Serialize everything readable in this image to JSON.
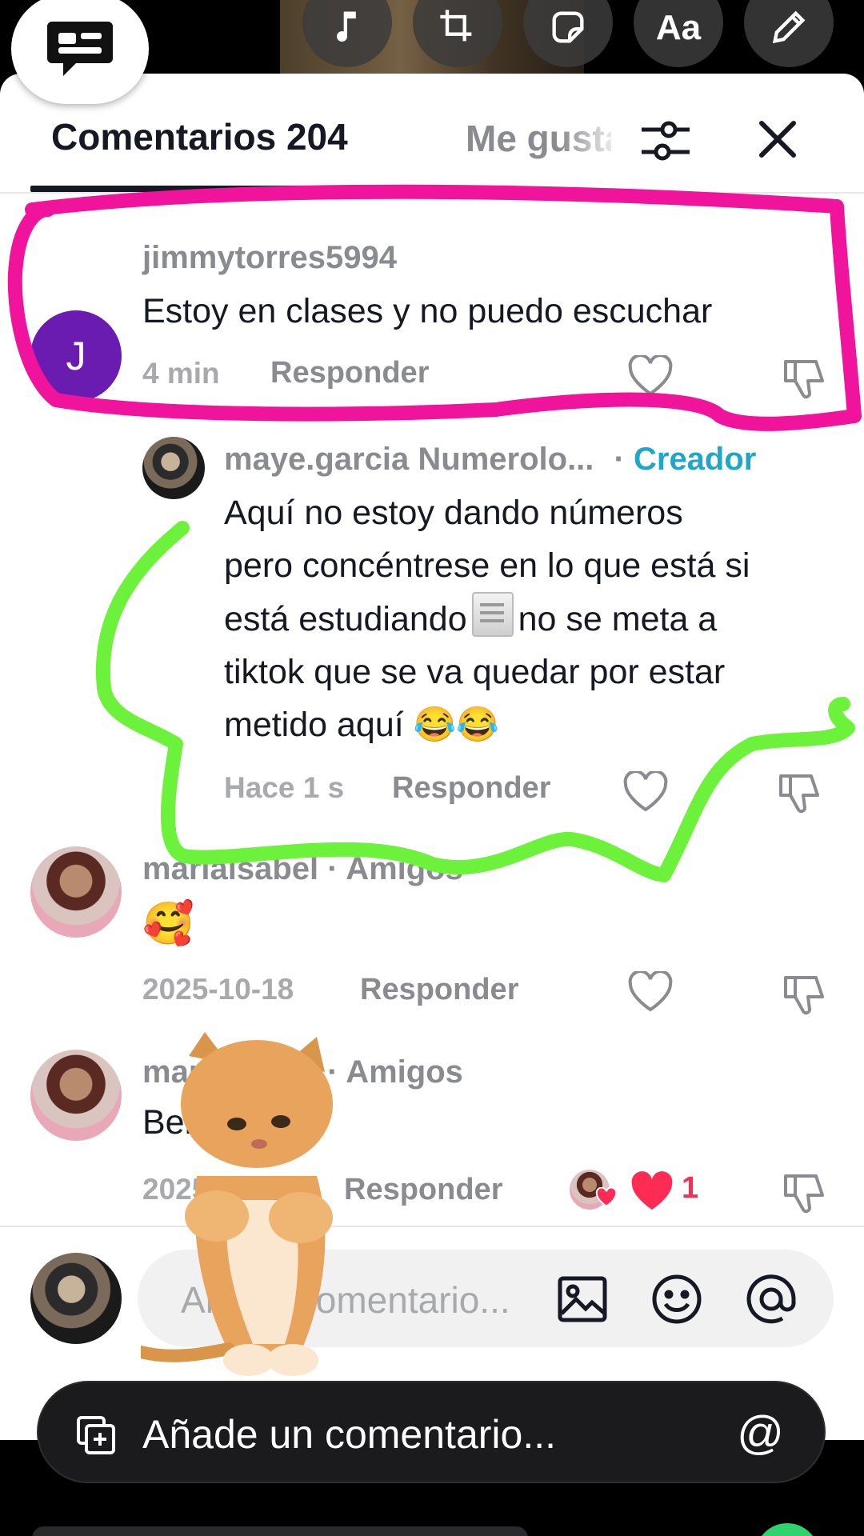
{
  "editor_toolbar": {
    "tools": [
      "music-icon",
      "crop-icon",
      "sticker-icon",
      "text-tool",
      "pencil-icon"
    ],
    "text_tool_label": "Aa"
  },
  "tabs": {
    "comments_label": "Comentarios 204",
    "likes_label": "Me gusta"
  },
  "comments": [
    {
      "username": "jimmytorres5994",
      "avatar_letter": "J",
      "text": "Estoy en clases y no puedo escuchar",
      "time": "4 min",
      "reply_label": "Responder"
    },
    {
      "username": "maye.garcia Numerolo...",
      "separator": "·",
      "badge": "Creador",
      "text_line1": "Aquí no estoy dando números",
      "text_line2": "pero concéntrese en lo que está si",
      "text_line3a": "está estudiando",
      "text_line3b": "no se meta a",
      "text_line4": "tiktok que se va quedar por estar",
      "text_line5": "metido aquí 😂😂",
      "time": "Hace 1 s",
      "reply_label": "Responder"
    },
    {
      "username": "mariaisabel · Amigos",
      "text": "🥰",
      "time": "2025-10-18",
      "reply_label": "Responder"
    },
    {
      "username": "mariaisabel · Amigos",
      "text": "Benditos",
      "time": "2025-10-18",
      "reply_label": "Responder",
      "like_count": "1"
    }
  ],
  "comment_input": {
    "placeholder": "Añadir comentario..."
  },
  "bottom_composer": {
    "placeholder": "Añade un comentario...",
    "mention": "@"
  },
  "annotation_colors": {
    "pink": "#f0139b",
    "green": "#6cf23a"
  },
  "colors": {
    "creator_badge": "#20a6c7",
    "like_red": "#fe2c55",
    "avatar_purple": "#6a1bb0"
  }
}
